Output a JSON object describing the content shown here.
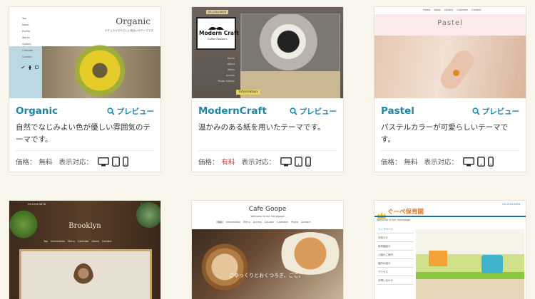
{
  "cards": [
    {
      "title": "Organic",
      "preview_label": "プレビュー",
      "desc": "自然でなじみよい色が優しい雰囲気のテーマです。",
      "price_label": "価格：",
      "price_value": "無料",
      "device_label": "表示対応：",
      "thumb": {
        "brand": "Organic",
        "subtitle": "ナチュラルでやさしい色合いのテーマです",
        "menu": [
          "Top",
          "News",
          "Profile",
          "Works",
          "Gallery",
          "Calendar",
          "Contact"
        ]
      }
    },
    {
      "title": "ModernCraft",
      "preview_label": "プレビュー",
      "desc": "温かみのある紙を用いたテーマです。",
      "price_label": "価格：",
      "price_value": "有料",
      "device_label": "表示対応：",
      "thumb": {
        "phone": "03-1234-5678",
        "brand_line1": "Modern Craft",
        "brand_line2": "Coffee Roasters",
        "menu": [
          "Home",
          "About",
          "Menu",
          "Access",
          "Photo Gallery"
        ],
        "tag": "Information"
      }
    },
    {
      "title": "Pastel",
      "preview_label": "プレビュー",
      "desc": "パステルカラーが可愛らしいテーマです。",
      "price_label": "価格：",
      "price_value": "無料",
      "device_label": "表示対応：",
      "thumb": {
        "brand": "Pastel",
        "nav": [
          "Home",
          "News",
          "Gallery",
          "Calendar",
          "Contact"
        ]
      }
    },
    {
      "thumb": {
        "brand": "Brooklyn",
        "phone": "03-1234-5678",
        "contact": "Contact",
        "nav": [
          "Top",
          "Information",
          "Menu",
          "Calendar",
          "About",
          "Contact"
        ]
      }
    },
    {
      "thumb": {
        "brand": "Cafe Goope",
        "subtitle": "Welcome to our homepage",
        "nav": [
          "Top",
          "Information",
          "Menu",
          "Access",
          "Coupon",
          "Calendar",
          "Photo",
          "Contact"
        ],
        "overlay": "ごゆっくりとおくつろぎ、ごこ。"
      }
    },
    {
      "thumb": {
        "brand": "ぐーぺ保育園",
        "phone": "03-1234-5678",
        "welcome": "Welcome to our homepage",
        "menu": [
          "トップページ",
          "お知らせ",
          "保育園紹介",
          "入園のご案内",
          "園内の紹介",
          "アクセス",
          "お問い合わせ"
        ]
      }
    }
  ],
  "colors": {
    "accent": "#1f86a8",
    "paid": "#d9333a",
    "background": "#f8f5ec"
  },
  "icons": {
    "preview": "search-icon",
    "devices": [
      "desktop-icon",
      "tablet-icon",
      "smartphone-icon"
    ]
  }
}
